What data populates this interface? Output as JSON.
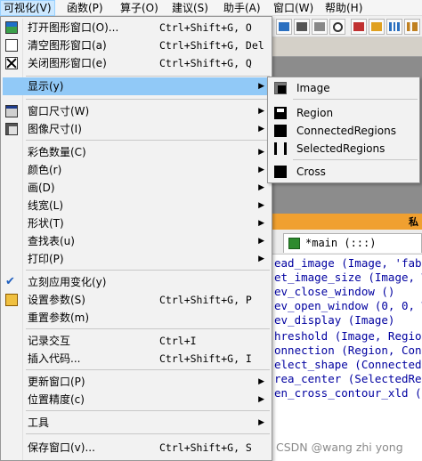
{
  "menubar": {
    "items": [
      {
        "label": "可视化(V)"
      },
      {
        "label": "函数(P)"
      },
      {
        "label": "算子(O)"
      },
      {
        "label": "建议(S)"
      },
      {
        "label": "助手(A)"
      },
      {
        "label": "窗口(W)"
      },
      {
        "label": "帮助(H)"
      }
    ]
  },
  "menu": {
    "items": [
      {
        "label": "打开图形窗口(O)...",
        "shortcut": "Ctrl+Shift+G, O",
        "icon": "open-window-icon"
      },
      {
        "label": "清空图形窗口(a)",
        "shortcut": "Ctrl+Shift+G, Del",
        "icon": "clear-window-icon"
      },
      {
        "label": "关闭图形窗口(e)",
        "shortcut": "Ctrl+Shift+G, Q",
        "icon": "close-window-icon"
      },
      {
        "label": "显示(y)",
        "submenu": true,
        "highlighted": true
      },
      {
        "label": "窗口尺寸(W)",
        "submenu": true,
        "icon": "window-size-icon"
      },
      {
        "label": "图像尺寸(I)",
        "submenu": true,
        "icon": "image-size-icon"
      },
      {
        "label": "彩色数量(C)",
        "submenu": true
      },
      {
        "label": "颜色(r)",
        "submenu": true
      },
      {
        "label": "画(D)",
        "submenu": true
      },
      {
        "label": "线宽(L)",
        "submenu": true
      },
      {
        "label": "形状(T)",
        "submenu": true
      },
      {
        "label": "查找表(u)",
        "submenu": true
      },
      {
        "label": "打印(P)",
        "submenu": true
      },
      {
        "label": "立刻应用变化(y)",
        "icon": "checkmark-icon"
      },
      {
        "label": "设置参数(S)",
        "shortcut": "Ctrl+Shift+G, P",
        "icon": "parameters-icon"
      },
      {
        "label": "重置参数(m)"
      },
      {
        "label": "记录交互",
        "shortcut": "Ctrl+I"
      },
      {
        "label": "插入代码...",
        "shortcut": "Ctrl+Shift+G, I"
      },
      {
        "label": "更新窗口(P)",
        "submenu": true
      },
      {
        "label": "位置精度(c)",
        "submenu": true
      },
      {
        "label": "工具",
        "submenu": true
      },
      {
        "label": "保存窗口(v)...",
        "shortcut": "Ctrl+Shift+G, S"
      }
    ]
  },
  "submenu": {
    "items": [
      {
        "label": "Image",
        "icon": "image-icon"
      },
      {
        "label": "Region",
        "icon": "region-icon"
      },
      {
        "label": "ConnectedRegions",
        "icon": "connected-regions-icon"
      },
      {
        "label": "SelectedRegions",
        "icon": "selected-regions-icon"
      },
      {
        "label": "Cross",
        "icon": "cross-icon"
      }
    ]
  },
  "editor": {
    "tab_label": "*main (:::)",
    "orange_tag": "私",
    "lines": [
      "ead_image (Image, 'fabr",
      "et_image_size (Image, W",
      "ev_close_window ()",
      "ev_open_window (0, 0, W",
      "ev_display (Image)",
      "hreshold (Image, Region",
      "onnection (Region, Conn",
      "elect_shape (ConnectedR",
      "rea_center (SelectedRe",
      "en_cross_contour_xld (C"
    ]
  },
  "watermark": "CSDN @wang zhi yong",
  "colors": {
    "highlight": "#91c9f7",
    "menubar_active": "#cce8ff",
    "code_text": "#0000a0",
    "orange_bar": "#f0a030"
  }
}
